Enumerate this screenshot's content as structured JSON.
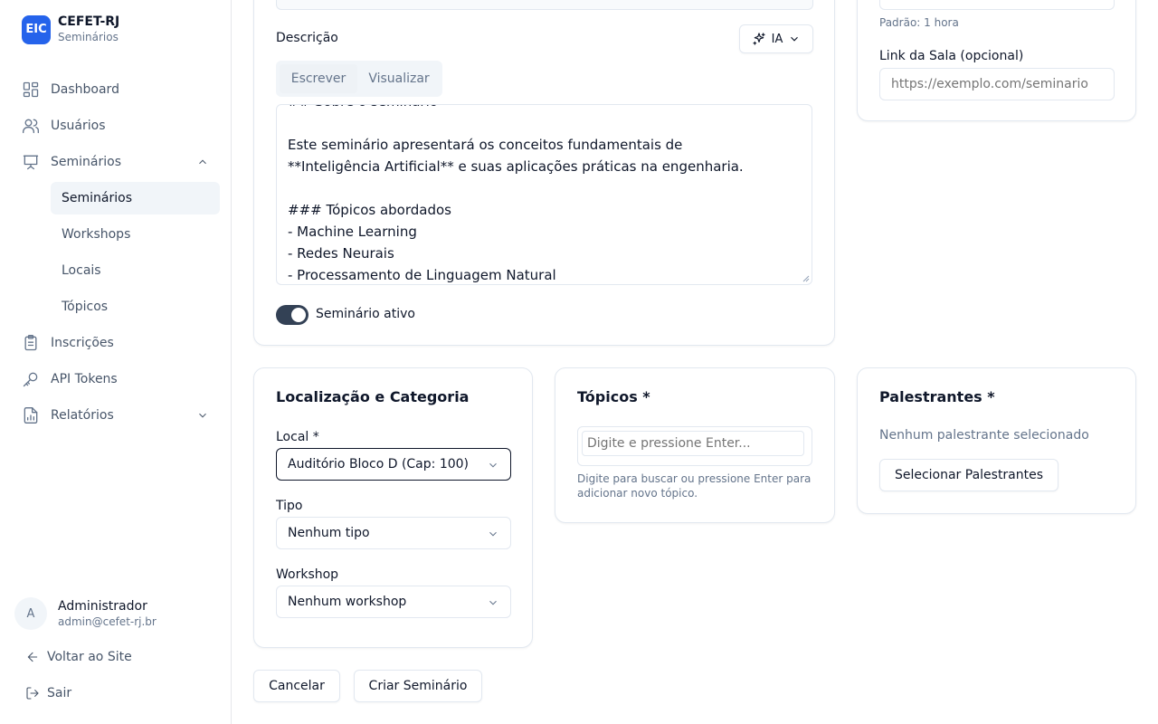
{
  "brand": {
    "logo": "EIC",
    "title": "CEFET-RJ",
    "subtitle": "Seminários",
    "color": "#2563eb"
  },
  "sidebar": {
    "items": [
      {
        "label": "Dashboard",
        "icon": "grid-icon"
      },
      {
        "label": "Usuários",
        "icon": "users-icon"
      },
      {
        "label": "Seminários",
        "icon": "presentation-icon"
      },
      {
        "label": "Inscrições",
        "icon": "clipboard-icon"
      },
      {
        "label": "API Tokens",
        "icon": "key-icon"
      },
      {
        "label": "Relatórios",
        "icon": "report-icon"
      }
    ],
    "sub_items": [
      {
        "label": "Seminários",
        "active": true
      },
      {
        "label": "Workshops"
      },
      {
        "label": "Locais"
      },
      {
        "label": "Tópicos"
      }
    ]
  },
  "user": {
    "initial": "A",
    "name": "Administrador",
    "email": "admin@cefet-rj.br"
  },
  "footer": {
    "back": "Voltar ao Site",
    "logout": "Sair"
  },
  "details": {
    "duration_hint": "Padrão: 1 hora",
    "room_link_label": "Link da Sala (opcional)",
    "room_link_placeholder": "https://exemplo.com/seminario"
  },
  "description": {
    "label": "Descrição",
    "ai_button": "IA",
    "tabs": [
      "Escrever",
      "Visualizar"
    ],
    "text": "## Sobre o seminário\n\nEste seminário apresentará os conceitos fundamentais de\n**Inteligência Artificial** e suas aplicações práticas na engenharia.\n\n### Tópicos abordados\n- Machine Learning\n- Redes Neurais\n- Processamento de Linguagem Natural",
    "active_toggle_label": "Seminário ativo",
    "active": true
  },
  "location": {
    "title": "Localização e Categoria",
    "local_label": "Local *",
    "local_value": "Auditório Bloco D (Cap: 100)",
    "type_label": "Tipo",
    "type_value": "Nenhum tipo",
    "workshop_label": "Workshop",
    "workshop_value": "Nenhum workshop"
  },
  "topics": {
    "title": "Tópicos *",
    "placeholder": "Digite e pressione Enter...",
    "hint": "Digite para buscar ou pressione Enter para adicionar novo tópico."
  },
  "speakers": {
    "title": "Palestrantes *",
    "empty": "Nenhum palestrante selecionado",
    "select_button": "Selecionar Palestrantes"
  },
  "actions": {
    "cancel": "Cancelar",
    "create": "Criar Seminário"
  }
}
